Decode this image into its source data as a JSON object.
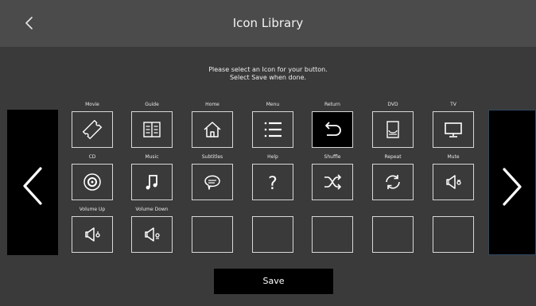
{
  "header": {
    "title": "Icon Library"
  },
  "instructions": {
    "line1": "Please select an Icon for your button.",
    "line2": "Select Save when done."
  },
  "save_label": "Save",
  "selected_icon": "Return",
  "rows": [
    [
      {
        "label": "Movie",
        "icon": "ticket-icon"
      },
      {
        "label": "Guide",
        "icon": "book-icon"
      },
      {
        "label": "Home",
        "icon": "home-icon"
      },
      {
        "label": "Menu",
        "icon": "list-icon"
      },
      {
        "label": "Return",
        "icon": "return-arrow-icon"
      },
      {
        "label": "DVD",
        "icon": "dvd-player-icon"
      },
      {
        "label": "TV",
        "icon": "tv-icon"
      }
    ],
    [
      {
        "label": "CD",
        "icon": "disc-icon"
      },
      {
        "label": "Music",
        "icon": "music-note-icon"
      },
      {
        "label": "Subtitles",
        "icon": "speech-bubble-icon"
      },
      {
        "label": "Help",
        "icon": "question-mark-icon"
      },
      {
        "label": "Shuffle",
        "icon": "shuffle-icon"
      },
      {
        "label": "Repeat",
        "icon": "repeat-icon"
      },
      {
        "label": "Mute",
        "icon": "speaker-mute-icon"
      }
    ],
    [
      {
        "label": "Volume Up",
        "icon": "speaker-volume-up-icon"
      },
      {
        "label": "Volume Down",
        "icon": "speaker-volume-down-icon"
      },
      {
        "label": "",
        "icon": ""
      },
      {
        "label": "",
        "icon": ""
      },
      {
        "label": "",
        "icon": ""
      },
      {
        "label": "",
        "icon": ""
      },
      {
        "label": "",
        "icon": ""
      }
    ]
  ]
}
